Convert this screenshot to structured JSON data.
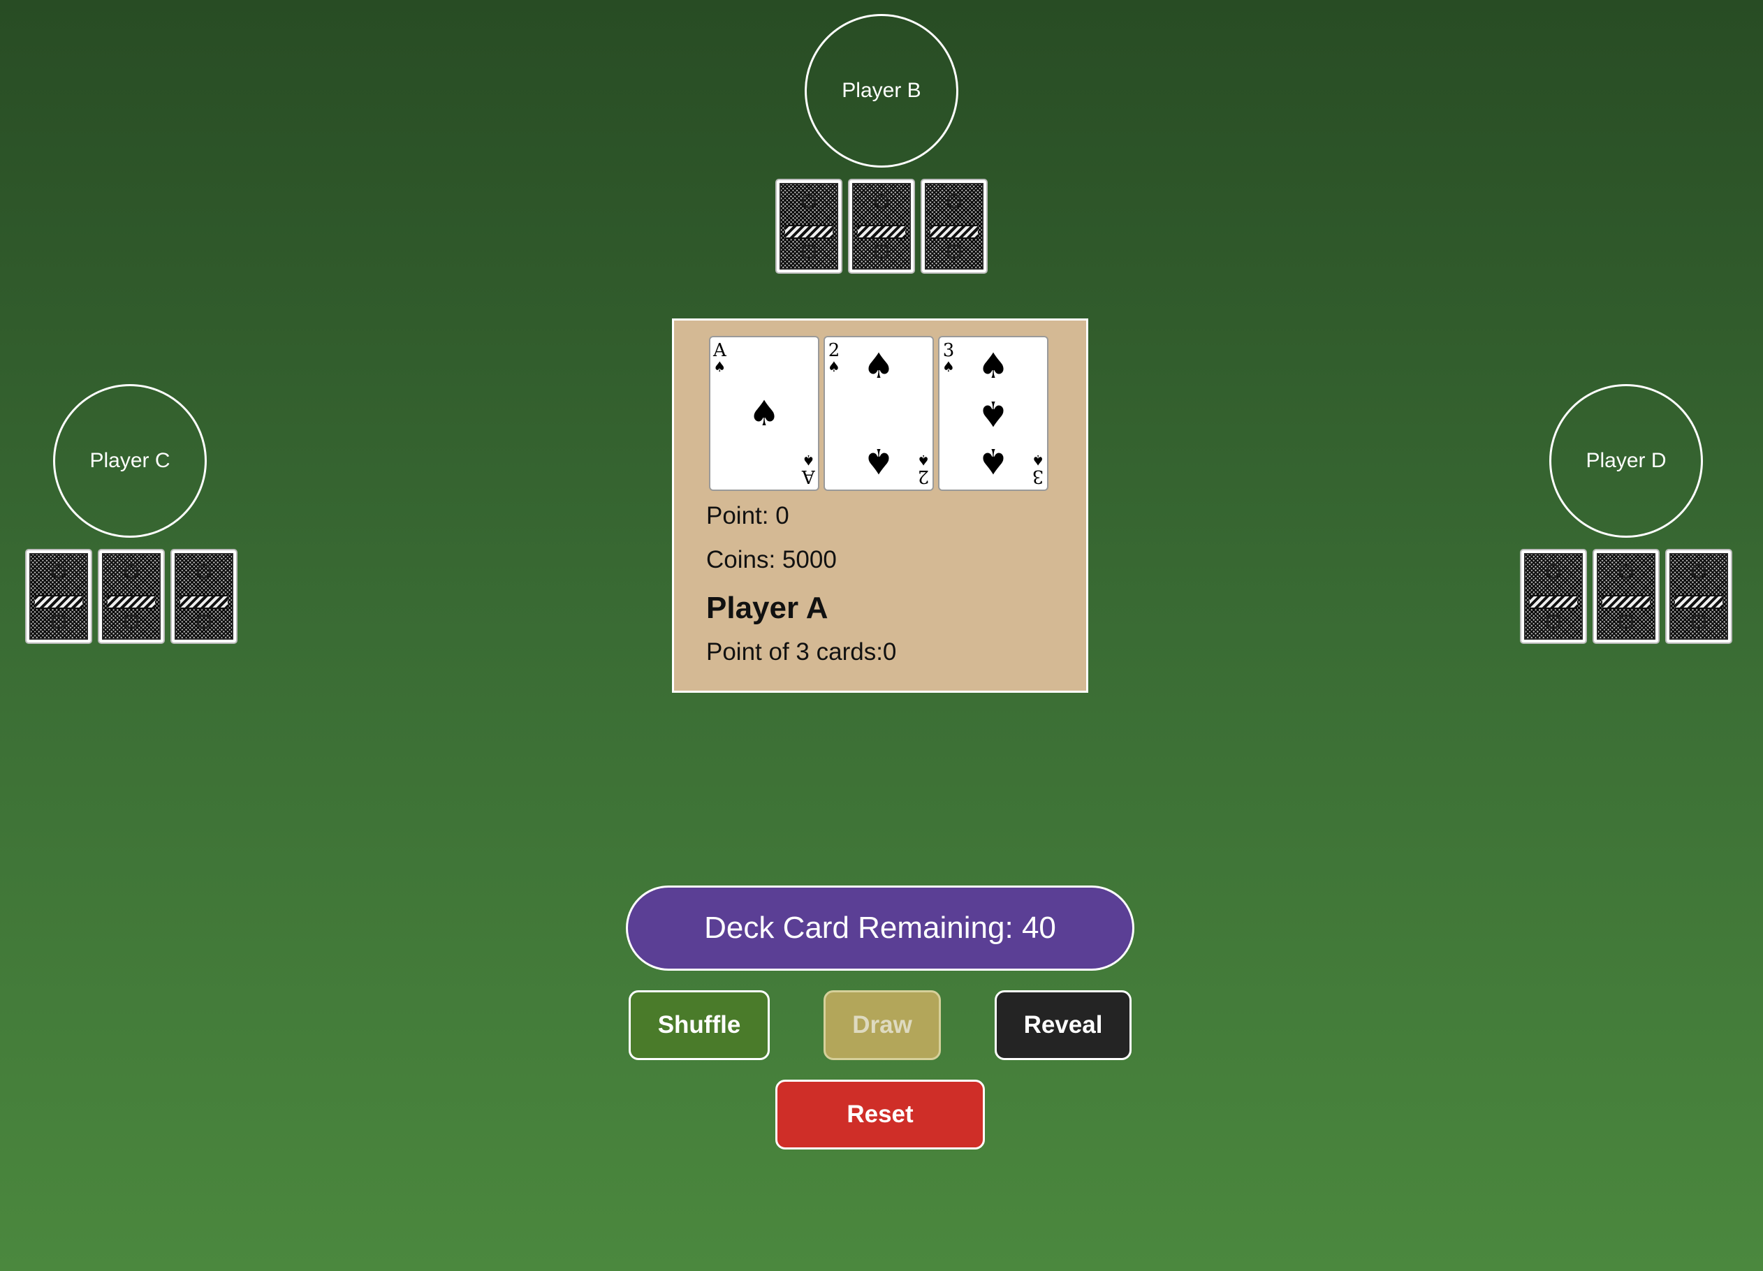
{
  "players": {
    "b": {
      "name": "Player B",
      "card_backs": 3
    },
    "c": {
      "name": "Player C",
      "card_backs": 3
    },
    "d": {
      "name": "Player D",
      "card_backs": 3
    }
  },
  "player_a": {
    "cards": [
      {
        "rank": "A",
        "suit": "♠"
      },
      {
        "rank": "2",
        "suit": "♠"
      },
      {
        "rank": "3",
        "suit": "♠"
      }
    ],
    "point_text": "Point: 0",
    "coins_text": "Coins: 5000",
    "name": "Player A",
    "three_card_point_text": "Point of 3 cards:0"
  },
  "deck": {
    "remaining_text": "Deck Card Remaining: 40"
  },
  "buttons": {
    "shuffle": "Shuffle",
    "draw": "Draw",
    "reveal": "Reveal",
    "reset": "Reset"
  },
  "colors": {
    "table_top": "#284c24",
    "table_bottom": "#4b883e",
    "panel": "#d4b994",
    "deck_pill": "#5b3f95",
    "shuffle": "#4a7b2a",
    "draw": "#b3a65a",
    "reveal": "#242424",
    "reset": "#cf2e28"
  }
}
